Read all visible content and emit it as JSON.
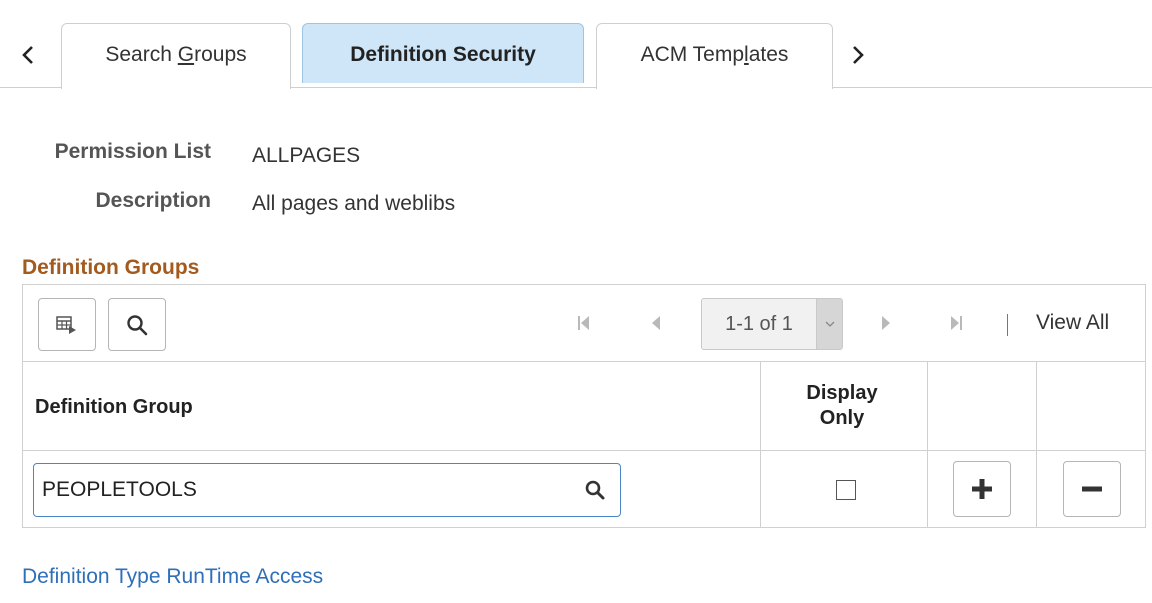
{
  "tabs": [
    {
      "label_pre": "Search ",
      "label_ul": "G",
      "label_post": "roups"
    },
    {
      "label": "Definition Security",
      "active": true
    },
    {
      "label_pre": "ACM Temp",
      "label_ul": "l",
      "label_post": "ates"
    }
  ],
  "fields": {
    "permission_list_label": "Permission List",
    "permission_list_value": "ALLPAGES",
    "description_label": "Description",
    "description_value": "All pages and weblibs"
  },
  "section": {
    "title": "Definition Groups"
  },
  "grid": {
    "pager_text": "1-1 of 1",
    "view_all": "View All",
    "headers": {
      "definition_group": "Definition Group",
      "display_only_line1": "Display",
      "display_only_line2": "Only"
    },
    "rows": [
      {
        "definition_group": "PEOPLETOOLS",
        "display_only": false
      }
    ]
  },
  "link": {
    "label": "Definition Type RunTime Access"
  },
  "colors": {
    "accent": "#a35a1f",
    "link": "#2f6fb8",
    "active_tab": "#cfe6f8"
  }
}
